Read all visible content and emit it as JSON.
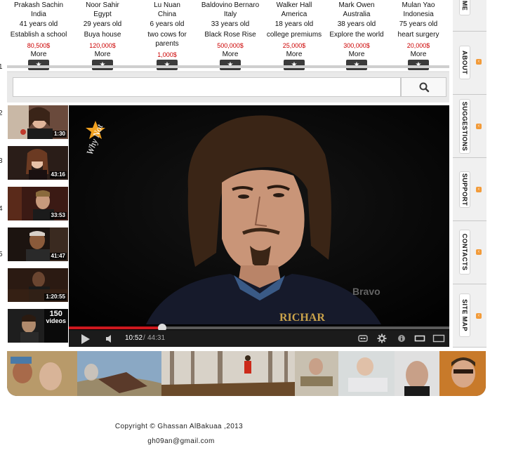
{
  "people": [
    {
      "name": "Prakash Sachin",
      "country": "India",
      "age": "41 years old",
      "goal": "Establish a school",
      "amount": "80,500$",
      "more": "More"
    },
    {
      "name": "Noor  Sahir",
      "country": "Egypt",
      "age": "29 years old",
      "goal": "Buya house",
      "amount": "120,000$",
      "more": "More"
    },
    {
      "name": "Lu  Nuan",
      "country": "China",
      "age": "6 years old",
      "goal": "two cows for parents",
      "amount": "1,000$",
      "more": "More"
    },
    {
      "name": "Baldovino  Bernaro",
      "country": "Italy",
      "age": "33 years old",
      "goal": "Black Rose Rise",
      "amount": "500,000$",
      "more": "More"
    },
    {
      "name": "Walker  Hall",
      "country": "America",
      "age": "18 years old",
      "goal": "college premiums",
      "amount": "25,000$",
      "more": "More"
    },
    {
      "name": "Mark Owen",
      "country": "Australia",
      "age": "38 years old",
      "goal": "Explore the world",
      "amount": "300,000$",
      "more": "More"
    },
    {
      "name": "Mulan Yao",
      "country": "Indonesia",
      "age": "75 years old",
      "goal": "heart surgery",
      "amount": "20,000$",
      "more": "More"
    }
  ],
  "star_glyph": "★",
  "row_numbers": [
    "1",
    "2",
    "3",
    "4",
    "5"
  ],
  "search": {
    "placeholder": "",
    "icon": "magnifier-icon"
  },
  "thumbnails": [
    {
      "duration": "1:30"
    },
    {
      "duration": "43:16"
    },
    {
      "duration": "33:53"
    },
    {
      "duration": "41:47"
    },
    {
      "duration": "1:20:55"
    },
    {
      "playlist_count": "150",
      "playlist_label": "videos"
    }
  ],
  "player": {
    "logo_text": "Why Not",
    "watermark": "Bravo",
    "current_time": "10:52",
    "separator": "/",
    "total_time": "44:31",
    "progress": 0.245
  },
  "side_tabs": [
    "ME",
    "ABOUT",
    "SUGGESTIONS",
    "SUPPORT",
    "CONTACTS",
    "SITE MAP"
  ],
  "footer": {
    "copyright": "Copyright © Ghassan AlBakuaa ,2013",
    "email": "gh09an@gmail.com"
  },
  "colors": {
    "amount": "#cc0000",
    "progress": "#cc181e",
    "tab_arrow": "#f29b3a"
  }
}
